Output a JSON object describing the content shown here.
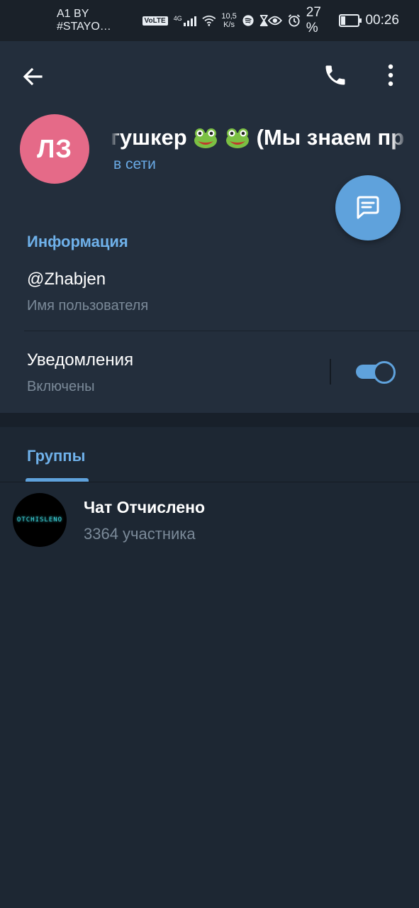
{
  "status_bar": {
    "carrier": "A1 BY #STAYO…",
    "volte": "VoLTE",
    "network": "4G",
    "speed_value": "10,5",
    "speed_unit": "K/s",
    "battery": "27 %",
    "battery_level": 0.27,
    "time": "00:26"
  },
  "header": {
    "avatar_initials": "ЛЗ",
    "name_part1": "гушкер",
    "name_part2": "(Мы знаем пр",
    "status": "в сети"
  },
  "info": {
    "section_title": "Информация",
    "username": "@Zhabjen",
    "username_caption": "Имя пользователя",
    "notifications_label": "Уведомления",
    "notifications_state": "Включены",
    "notifications_on": true
  },
  "groups": {
    "tab_label": "Группы",
    "items": [
      {
        "name": "Чат Отчислено",
        "members": "3364 участника",
        "avatar_text": "OTCHISLENO"
      }
    ]
  },
  "colors": {
    "accent": "#5fa2dc",
    "link": "#6fb1ea",
    "avatar_bg": "#e56a88",
    "header_bg": "#232e3c",
    "page_bg": "#1d2733"
  }
}
